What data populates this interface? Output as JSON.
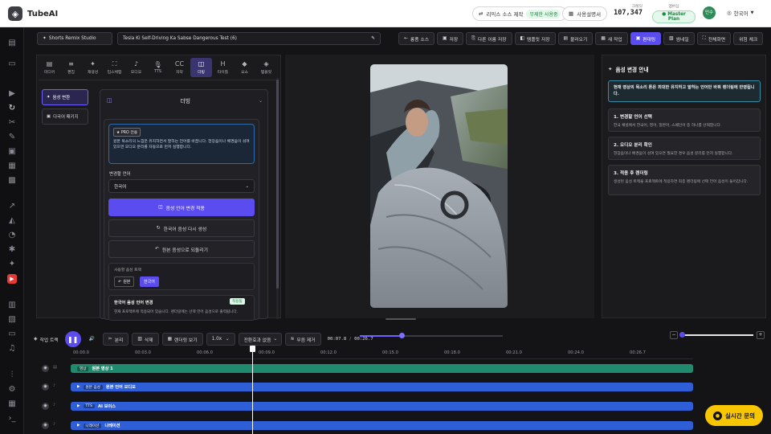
{
  "app": {
    "name": "TubeAI"
  },
  "topbar": {
    "remix_label": "리믹스 소스 제작",
    "remix_badge": "무제한 사용중",
    "usage_label": "사용설명서",
    "credit_label": "크레딧",
    "credit_value": "107,347",
    "plan_label": "Master Plan",
    "plan_caption": "멤버십",
    "avatar_text": "민수",
    "language": "한국어"
  },
  "project": {
    "studio_label": "Shorts Remix Studio",
    "title": "Tesla Ki Self-Driving Ka Sabse Dangerous Test (6)",
    "buttons": [
      {
        "label": "롱폼 소스",
        "icon": "←"
      },
      {
        "label": "저장",
        "icon": "▣"
      },
      {
        "label": "다른 이름 저장",
        "icon": "⎘"
      },
      {
        "label": "템플릿 저장",
        "icon": "◧"
      },
      {
        "label": "불러오기",
        "icon": "▤"
      },
      {
        "label": "새 작업",
        "icon": "▦"
      },
      {
        "label": "편대링",
        "icon": "▣"
      },
      {
        "label": "썸네일",
        "icon": "▧"
      },
      {
        "label": "전체화면",
        "icon": "⛶"
      },
      {
        "label": "위험 체크",
        "icon": ""
      }
    ]
  },
  "tools": {
    "tabs": [
      {
        "label": "미디어",
        "icon": "▤"
      },
      {
        "label": "편집",
        "icon": "≡"
      },
      {
        "label": "재생성",
        "icon": "✦"
      },
      {
        "label": "입스체험",
        "icon": "⛶"
      },
      {
        "label": "오디오",
        "icon": "♪"
      },
      {
        "label": "TTS",
        "icon": "🎙"
      },
      {
        "label": "자막",
        "icon": "CC"
      },
      {
        "label": "더빙",
        "icon": "◫"
      },
      {
        "label": "타이틀",
        "icon": "H"
      },
      {
        "label": "요소",
        "icon": "◆"
      },
      {
        "label": "템플릿",
        "icon": "◈"
      }
    ],
    "side": [
      {
        "label": "음성 변환"
      },
      {
        "label": "다국어 패키지"
      }
    ],
    "section_title": "더빙",
    "pro_label": "PRO 전용",
    "pro_desc": "원본 목소리의 느낌은 유지하면서 말하는 언어를 바꿉니다. 현장음이나 배경음이 섞여 있으면 오디오 분리를 자동으로 먼저 실행합니다.",
    "lang_label": "변경할 언어",
    "lang_value": "한국어",
    "apply_btn": "음성 언어 변경 적용",
    "regen_btn": "한국어 음성 다시 생성",
    "revert_btn": "원본 음성으로 되돌리기",
    "track_label": "사용할 음성 트랙",
    "track_original": "원본",
    "track_korean": "한국어",
    "status_title": "한국어 음성 언어 변경",
    "status_badge": "적용됨",
    "status_desc": "현재 프로젝트에 적용되어 있습니다. 렌더링에는 선택 언어 음성으로 출력됩니다."
  },
  "guide": {
    "title": "음성 변경 안내",
    "highlight": "현재 영상의 목소리 톤은 최대한 유지하고 말하는 언어만 바꿔 렌더링에 반영됩니다.",
    "steps": [
      {
        "title": "1. 변경할 언어 선택",
        "desc": "한국 채널에서 한국어, 영어, 일본어, 스페인어 중 하나를 선택합니다."
      },
      {
        "title": "2. 오디오 분리 확인",
        "desc": "현장음이나 배경음이 섞여 있으면 필요한 경우 음성 분리를 먼저 실행합니다."
      },
      {
        "title": "3. 적용 후 렌더링",
        "desc": "생성된 음성 트랙을 프로젝트에 적용하면 최종 렌더링에 선택 언어 음성이 들어갑니다."
      }
    ]
  },
  "timeline": {
    "label": "작업 트랙",
    "split": "분리",
    "delete": "삭제",
    "render_preview": "렌더링 보기",
    "speed": "1.0x",
    "transition": "전환효과 없음",
    "silence": "무음 제거",
    "time_current": "00:07.8",
    "time_total": "00:26.7",
    "time_sep": "/",
    "ruler": [
      "00:00.0",
      "00:03.0",
      "00:06.0",
      "00:09.0",
      "00:12.0",
      "00:15.0",
      "00:18.0",
      "00:21.0",
      "00:24.0",
      "00:26.7"
    ],
    "playhead_fraction": 0.292,
    "tracks": [
      {
        "chip": "영상",
        "name": "원본 영상 1",
        "color": "#1f8a6e"
      },
      {
        "chip": "원본 음성",
        "name": "원본 언어 오디오",
        "color": "#2f5fd6"
      },
      {
        "chip": "TTS",
        "name": "AI 보이스",
        "color": "#2f5fd6"
      },
      {
        "chip": "나레이션",
        "name": "나레이션",
        "color": "#2f5fd6"
      }
    ]
  },
  "chat": {
    "label": "실시간 문의"
  },
  "colors": {
    "accent": "#5b4cf0",
    "chat_bg": "#f7c600",
    "video_track": "#1f8a6e",
    "audio_track": "#2f5fd6"
  }
}
